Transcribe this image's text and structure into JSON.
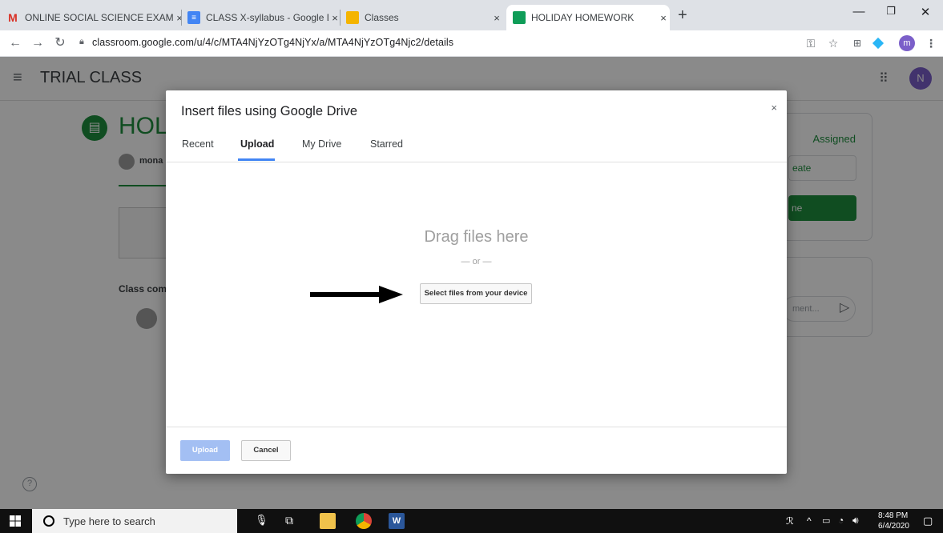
{
  "browser": {
    "tabs": [
      {
        "label": "ONLINE SOCIAL SCIENCE EXAM",
        "favicon": "gmail-icon",
        "color": "#d93025"
      },
      {
        "label": "CLASS X-syllabus - Google Docs",
        "favicon": "docs-icon",
        "color": "#4285f4"
      },
      {
        "label": "Classes",
        "favicon": "classroom-icon",
        "color": "#f4b400"
      },
      {
        "label": "HOLIDAY HOMEWORK",
        "favicon": "classroom-icon",
        "color": "#0f9d58",
        "active": true
      }
    ],
    "tab_close": "×",
    "new_tab": "+",
    "url": "classroom.google.com/u/4/c/MTA4NjYzOTg4NjYx/a/MTA4NjYzOTg4Njc2/details",
    "profile_initial": "m"
  },
  "app": {
    "class_name": "TRIAL CLASS",
    "avatar_initial": "N",
    "assignment_title": "HOL",
    "author": "mona",
    "class_comments": "Class com",
    "status": "Assigned",
    "create_label": "eate",
    "done_label": "ne",
    "comment_placeholder": "ment..."
  },
  "dialog": {
    "title": "Insert files using Google Drive",
    "close": "×",
    "tabs": [
      "Recent",
      "Upload",
      "My Drive",
      "Starred"
    ],
    "active_tab": "Upload",
    "drag_text": "Drag files here",
    "or_text": "— or —",
    "select_button": "Select files from your device",
    "upload_button": "Upload",
    "cancel_button": "Cancel"
  },
  "taskbar": {
    "search_placeholder": "Type here to search",
    "time": "8:48 PM",
    "date": "6/4/2020"
  },
  "colors": {
    "classroom_green": "#1e8e3e",
    "drive_blue": "#4285f4",
    "avatar_purple": "#7b5fc9"
  }
}
